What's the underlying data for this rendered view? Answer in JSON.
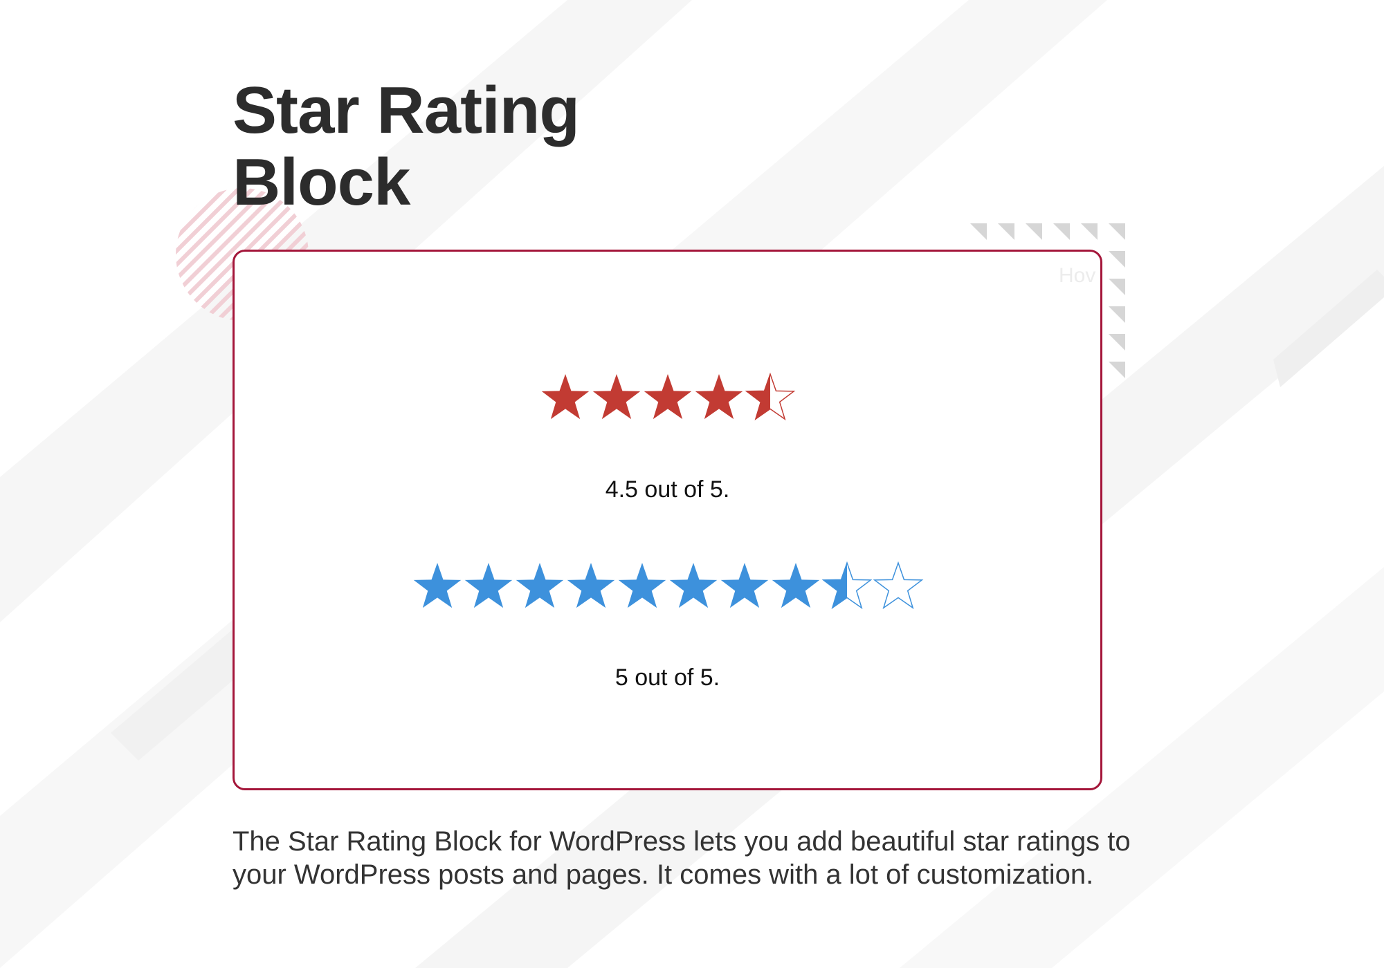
{
  "page": {
    "title_line1": "Star Rating",
    "title_line2": "Block",
    "description_line1": "The Star Rating Block for WordPress lets you add beautiful star ratings to",
    "description_line2": "your WordPress posts and pages. It comes with a lot of customization."
  },
  "demo": {
    "faint_label": "Hov",
    "ratings": [
      {
        "value": 4.5,
        "max": 5,
        "color": "#c23b33",
        "caption": "4.5 out of 5."
      },
      {
        "value": 8.5,
        "max": 10,
        "color": "#3d91dc",
        "caption": "5 out of 5."
      }
    ]
  },
  "colors": {
    "card_border": "#a4163a",
    "title": "#2c2c2c",
    "text": "#333333"
  },
  "icons": [
    "star-icon",
    "star-half-icon",
    "star-outline-icon"
  ]
}
